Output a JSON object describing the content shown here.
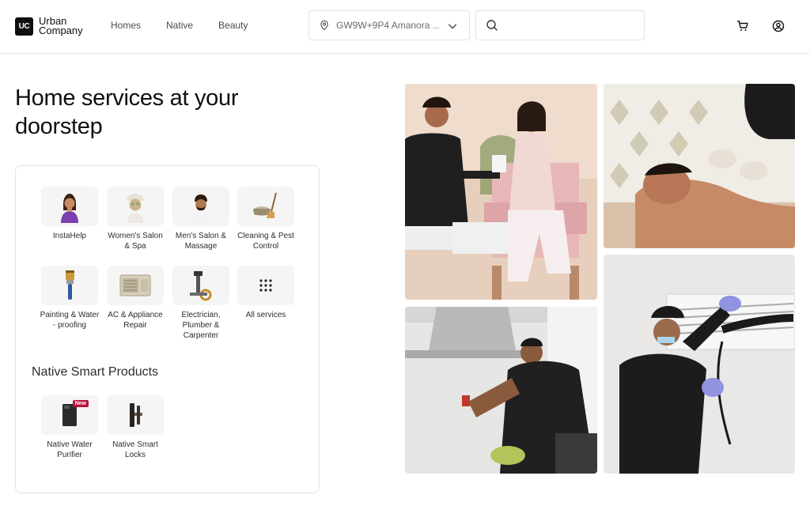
{
  "logo": {
    "mark": "UC",
    "line1": "Urban",
    "line2": "Company"
  },
  "nav": [
    "Homes",
    "Native",
    "Beauty"
  ],
  "location": {
    "value": "GW9W+9P4 Amanora ..."
  },
  "search": {
    "placeholder": ""
  },
  "hero": {
    "title": "Home services at your doorstep"
  },
  "services": [
    {
      "label": "InstaHelp",
      "icon": "instahelp-icon"
    },
    {
      "label": "Women's Salon & Spa",
      "icon": "womens-salon-icon"
    },
    {
      "label": "Men's Salon & Massage",
      "icon": "mens-salon-icon"
    },
    {
      "label": "Cleaning & Pest Control",
      "icon": "cleaning-icon"
    },
    {
      "label": "Painting & Water - proofing",
      "icon": "paint-brush-icon"
    },
    {
      "label": "AC & Appliance Repair",
      "icon": "ac-unit-icon"
    },
    {
      "label": "Electrician, Plumber & Carpenter",
      "icon": "tools-icon"
    },
    {
      "label": "All services",
      "icon": "grid-icon"
    }
  ],
  "native_section": {
    "title": "Native Smart Products",
    "items": [
      {
        "label": "Native Water Purifier",
        "badge": "New",
        "icon": "water-purifier-icon"
      },
      {
        "label": "Native Smart Locks",
        "icon": "smart-lock-icon"
      }
    ]
  },
  "colors": {
    "brand": "#0f0f0f",
    "badge": "#b4123d",
    "border": "#e3e3e3"
  }
}
